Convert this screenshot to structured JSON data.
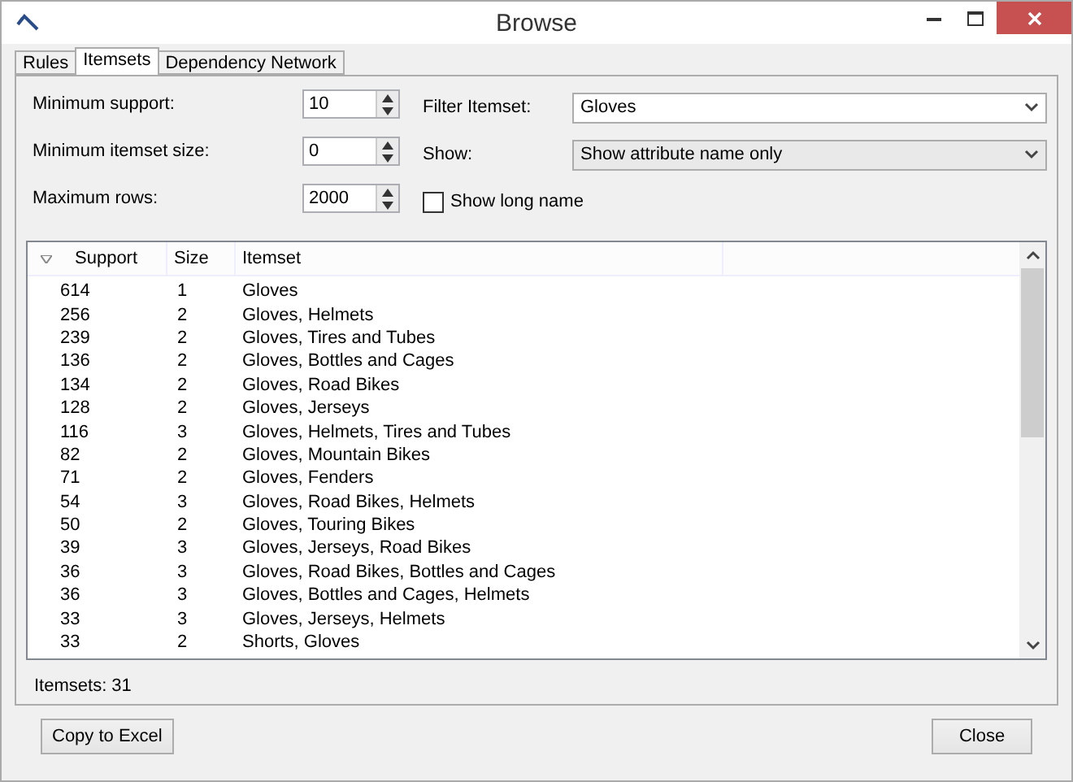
{
  "window": {
    "title": "Browse"
  },
  "tabs": [
    {
      "label": "Rules",
      "selected": false
    },
    {
      "label": "Itemsets",
      "selected": true
    },
    {
      "label": "Dependency Network",
      "selected": false
    }
  ],
  "fields": [
    {
      "label": "Minimum support:",
      "value": "10"
    },
    {
      "label": "Minimum itemset size:",
      "value": "0"
    },
    {
      "label": "Maximum rows:",
      "value": "2000"
    }
  ],
  "filter_itemset": {
    "label": "Filter Itemset:",
    "value": "Gloves"
  },
  "show": {
    "label": "Show:",
    "value": "Show attribute name only"
  },
  "show_long_name": {
    "label": "Show long name",
    "checked": false
  },
  "table": {
    "columns": [
      "Support",
      "Size",
      "Itemset"
    ],
    "rows": [
      [
        "614",
        "1",
        "Gloves"
      ],
      [
        "256",
        "2",
        "Gloves, Helmets"
      ],
      [
        "239",
        "2",
        "Gloves, Tires and Tubes"
      ],
      [
        "136",
        "2",
        "Gloves, Bottles and Cages"
      ],
      [
        "134",
        "2",
        "Gloves, Road Bikes"
      ],
      [
        "128",
        "2",
        "Gloves, Jerseys"
      ],
      [
        "116",
        "3",
        "Gloves, Helmets, Tires and Tubes"
      ],
      [
        "82",
        "2",
        "Gloves, Mountain Bikes"
      ],
      [
        "71",
        "2",
        "Gloves, Fenders"
      ],
      [
        "54",
        "3",
        "Gloves, Road Bikes, Helmets"
      ],
      [
        "50",
        "2",
        "Gloves, Touring Bikes"
      ],
      [
        "39",
        "3",
        "Gloves, Jerseys, Road Bikes"
      ],
      [
        "36",
        "3",
        "Gloves, Road Bikes, Bottles and Cages"
      ],
      [
        "36",
        "3",
        "Gloves, Bottles and Cages, Helmets"
      ],
      [
        "33",
        "3",
        "Gloves, Jerseys, Helmets"
      ],
      [
        "33",
        "2",
        "Shorts, Gloves"
      ]
    ]
  },
  "status": "Itemsets: 31",
  "buttons": [
    "Copy to Excel",
    "Close"
  ]
}
